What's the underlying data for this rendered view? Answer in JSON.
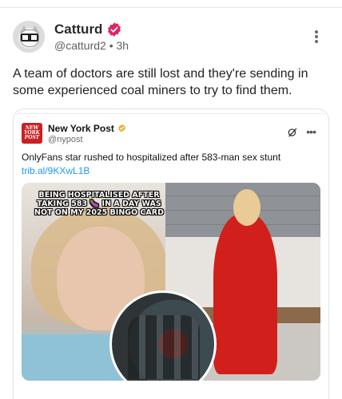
{
  "post": {
    "author": {
      "display_name": "Catturd",
      "handle": "@catturd2",
      "time": "3h",
      "separator": "•"
    },
    "text": "A team of doctors are still lost and they're sending in some experienced coal miners to try to find them."
  },
  "quoted_post": {
    "author": {
      "display_name": "New York Post",
      "handle": "@nypost",
      "logo_text": "NEW YORK POST"
    },
    "text": "OnlyFans star rushed to hospitalized after 583-man sex stunt",
    "link": "trib.al/9KXwL1B",
    "media_caption": "BEING HOSPITALISED AFTER TAKING 583 🍆 IN A DAY WAS NOT ON MY 2025 BINGO CARD"
  },
  "colors": {
    "verified_badge": "#e0245e",
    "gold_badge": "#e8b33a",
    "link": "#1d9bf0",
    "nyp_red": "#cc1f1f"
  },
  "icons": {
    "verified": "verified-badge-icon",
    "more": "more-options-icon",
    "grok": "grok-icon"
  }
}
